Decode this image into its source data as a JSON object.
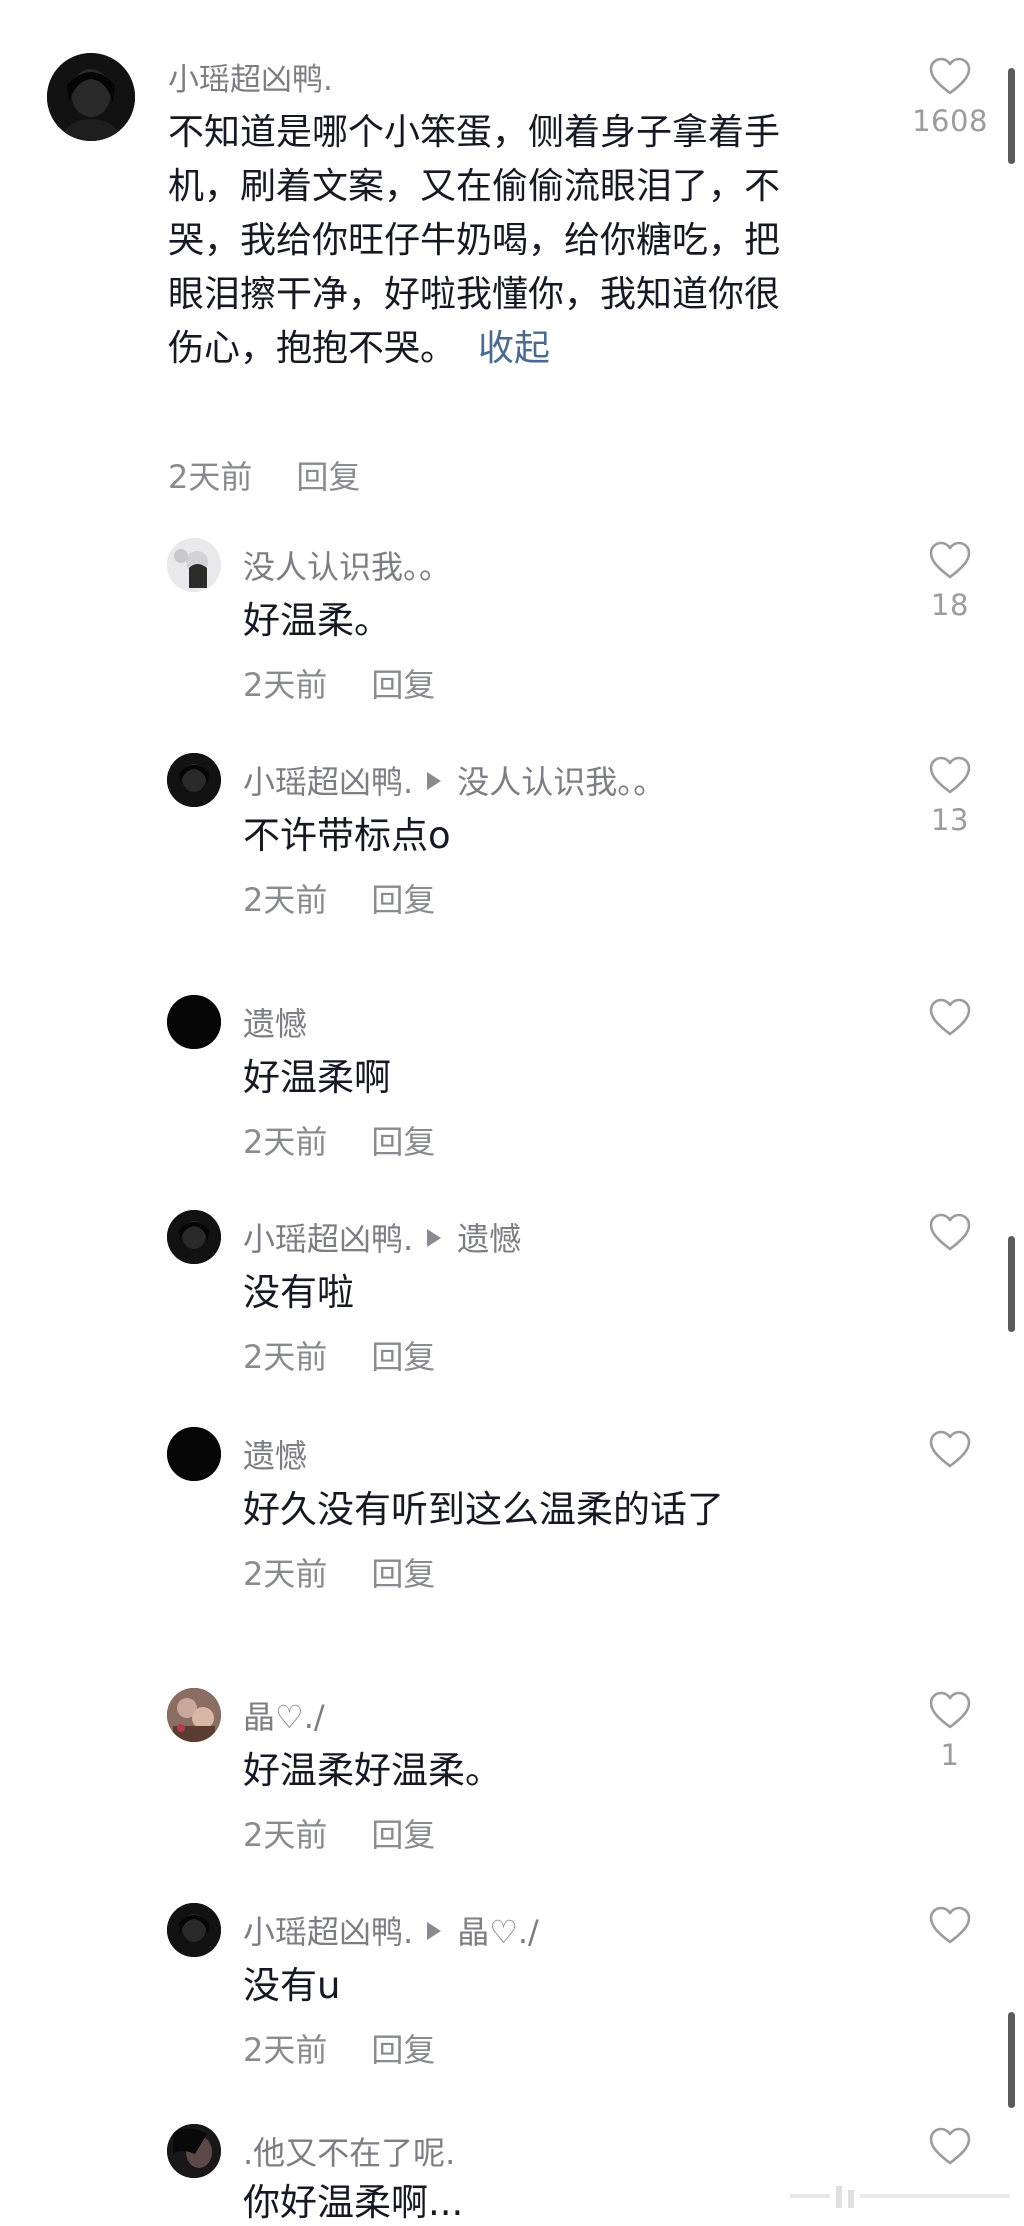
{
  "comments": [
    {
      "username": "小瑶超凶鸭.",
      "text": "不知道是哪个小笨蛋，侧着身子拿着手机，刷着文案，又在偷偷流眼泪了，不哭，我给你旺仔牛奶喝，给你糖吃，把眼泪擦干净，好啦我懂你，我知道你很伤心，抱抱不哭。",
      "collapse_label": "收起",
      "time": "2天前",
      "reply_label": "回复",
      "likes": "1608"
    }
  ],
  "replies": [
    {
      "username": "没人认识我。。",
      "reply_to": "",
      "text": "好温柔。",
      "time": "2天前",
      "reply_label": "回复",
      "likes": "18"
    },
    {
      "username": "小瑶超凶鸭.",
      "reply_to": "没人认识我。。",
      "text": "不许带标点o",
      "time": "2天前",
      "reply_label": "回复",
      "likes": "13"
    },
    {
      "username": "遗憾",
      "reply_to": "",
      "text": "好温柔啊",
      "time": "2天前",
      "reply_label": "回复",
      "likes": ""
    },
    {
      "username": "小瑶超凶鸭.",
      "reply_to": "遗憾",
      "text": "没有啦",
      "time": "2天前",
      "reply_label": "回复",
      "likes": ""
    },
    {
      "username": "遗憾",
      "reply_to": "",
      "text": "好久没有听到这么温柔的话了",
      "time": "2天前",
      "reply_label": "回复",
      "likes": ""
    },
    {
      "username": "晶♡./",
      "reply_to": "",
      "text": "好温柔好温柔。",
      "time": "2天前",
      "reply_label": "回复",
      "likes": "1"
    },
    {
      "username": "小瑶超凶鸭.",
      "reply_to": "晶♡./",
      "text": "没有u",
      "time": "2天前",
      "reply_label": "回复",
      "likes": ""
    },
    {
      "username": ".他又不在了呢.",
      "reply_to": "",
      "text": "你好温柔啊...",
      "time": "",
      "reply_label": "",
      "likes": ""
    }
  ],
  "icons": {
    "like": "heart-outline-icon",
    "reply_arrow": "triangle-right-icon"
  },
  "colors": {
    "username": "#7d7d84",
    "text": "#161823",
    "meta": "#8a8b91",
    "collapse_link": "#4a6a8e",
    "like_count": "#9b9ba1"
  }
}
